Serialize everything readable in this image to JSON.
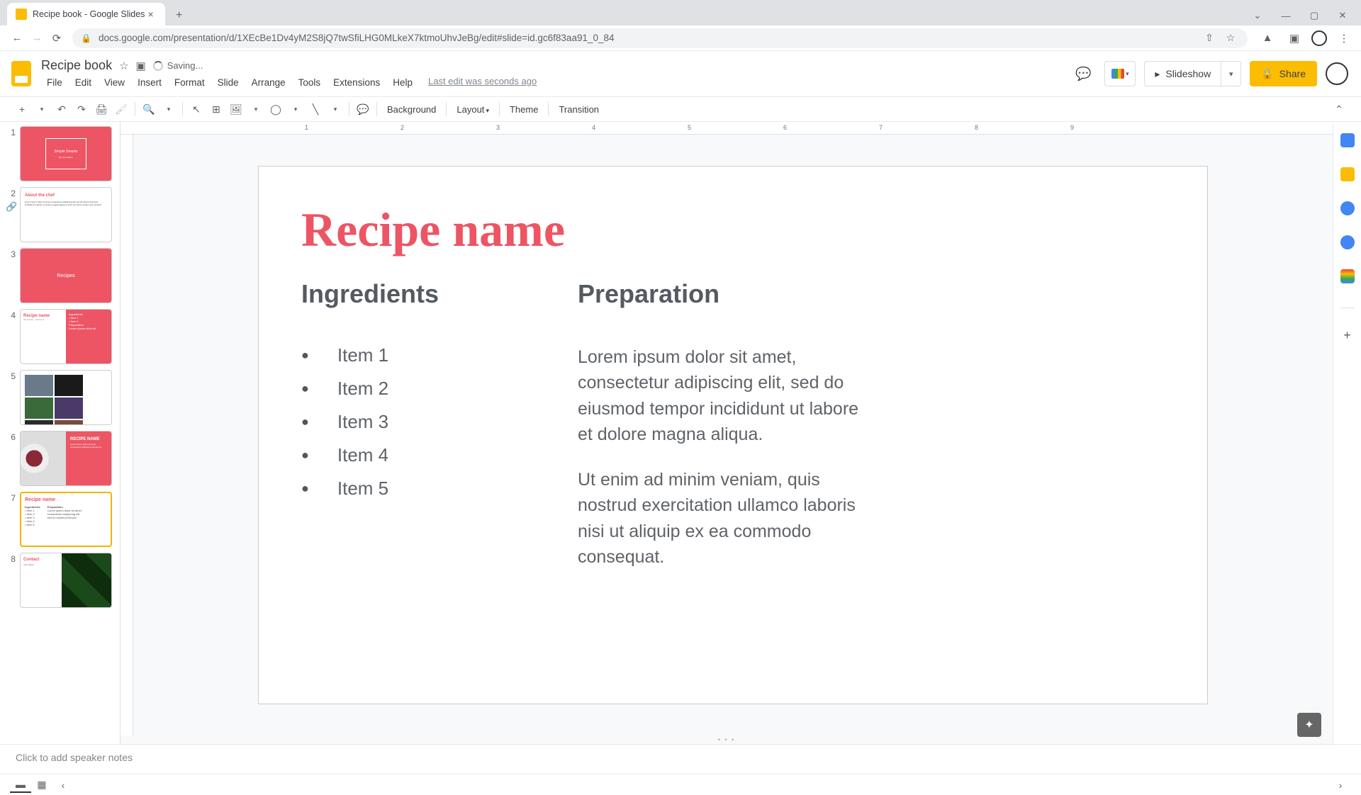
{
  "browser": {
    "tab_title": "Recipe book - Google Slides",
    "url": "docs.google.com/presentation/d/1XEcBe1Dv4yM2S8jQ7twSfiLHG0MLkeX7ktmoUhvJeBg/edit#slide=id.gc6f83aa91_0_84"
  },
  "doc": {
    "title": "Recipe book",
    "saving": "Saving...",
    "last_edit": "Last edit was seconds ago"
  },
  "menus": [
    "File",
    "Edit",
    "View",
    "Insert",
    "Format",
    "Slide",
    "Arrange",
    "Tools",
    "Extensions",
    "Help"
  ],
  "toolbar": {
    "background": "Background",
    "layout": "Layout",
    "theme": "Theme",
    "transition": "Transition"
  },
  "actions": {
    "slideshow": "Slideshow",
    "share": "Share"
  },
  "slide": {
    "title": "Recipe name",
    "ingredients_h": "Ingredients",
    "prep_h": "Preparation",
    "ingredients": [
      "Item 1",
      "Item 2",
      "Item 3",
      "Item 4",
      "Item 5"
    ],
    "prep1": "Lorem ipsum dolor sit amet, consectetur adipiscing elit, sed do eiusmod tempor incididunt ut labore et dolore magna aliqua.",
    "prep2": "Ut enim ad minim veniam, quis nostrud exercitation ullamco laboris nisi ut aliquip ex ea commodo consequat."
  },
  "notes_placeholder": "Click to add speaker notes",
  "thumbs": {
    "t1_title": "Simple Snacks",
    "t1_sub": "By Your Name",
    "t2_h": "About the chef",
    "t3": "Recipes",
    "t4_h": "Recipe name",
    "t6_h": "RECIPE NAME",
    "t7_h": "Recipe name",
    "t7_c1": "Ingredients",
    "t7_c2": "Preparation",
    "t8_h": "Contact"
  },
  "ruler_ticks": [
    "1",
    "2",
    "3",
    "4",
    "5",
    "6",
    "7",
    "8",
    "9"
  ],
  "selected_slide": 7,
  "slide_count": 8
}
